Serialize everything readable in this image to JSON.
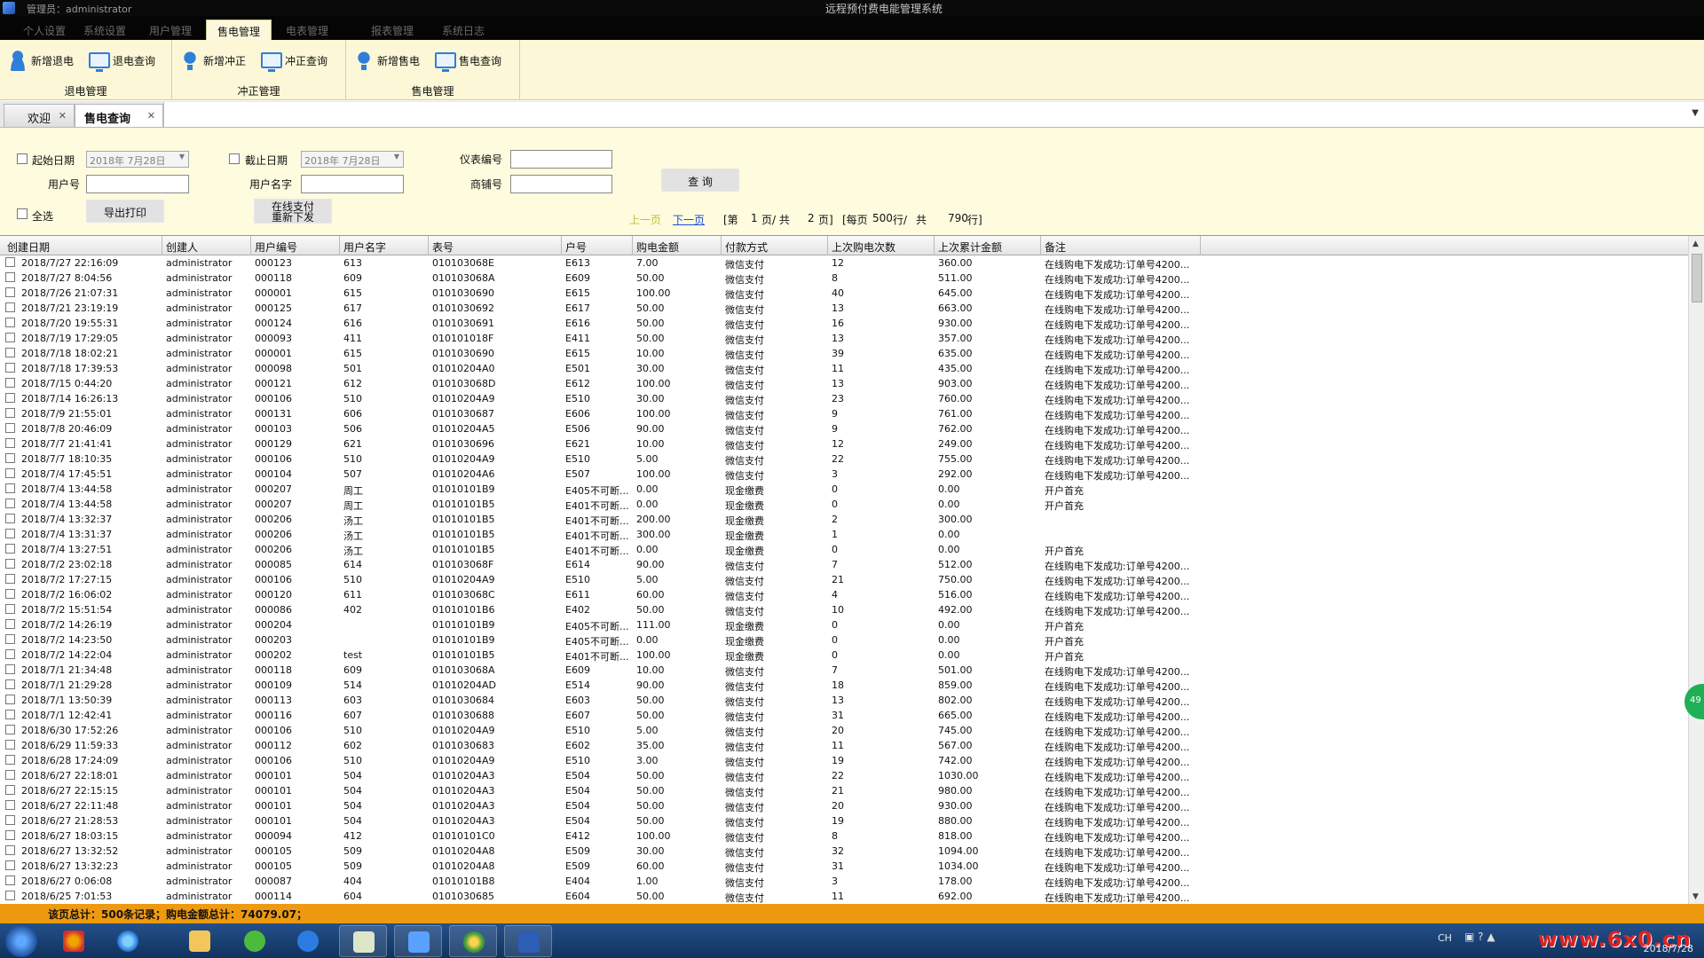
{
  "window": {
    "title": "远程预付费电能管理系统",
    "login_text": "管理员：administrator"
  },
  "ribbon": {
    "tabs": [
      "个人设置",
      "系统设置",
      "用户管理",
      "售电管理",
      "电表管理",
      "报表管理",
      "系统日志"
    ],
    "active_tab": "售电管理",
    "groups": [
      {
        "label": "退电管理",
        "buttons": [
          {
            "label": "新增退电",
            "icon": "person-add-icon"
          },
          {
            "label": "退电查询",
            "icon": "monitor-search-icon"
          }
        ]
      },
      {
        "label": "冲正管理",
        "buttons": [
          {
            "label": "新增冲正",
            "icon": "bulb-add-icon"
          },
          {
            "label": "冲正查询",
            "icon": "monitor-search-icon"
          }
        ]
      },
      {
        "label": "售电管理",
        "buttons": [
          {
            "label": "新增售电",
            "icon": "bulb-add-icon"
          },
          {
            "label": "售电查询",
            "icon": "monitor-search-icon"
          }
        ]
      }
    ]
  },
  "doc_tabs": [
    {
      "label": "欢迎",
      "active": false
    },
    {
      "label": "售电查询",
      "active": true
    }
  ],
  "filter": {
    "start_date_label": "起始日期",
    "start_date_value": "2018年 7月28日",
    "end_date_label": "截止日期",
    "end_date_value": "2018年 7月28日",
    "meter_label": "仪表编号",
    "user_no_label": "用户号",
    "user_name_label": "用户名字",
    "shop_label": "商铺号",
    "query_button": "查 询",
    "select_all_label": "全选",
    "export_button": "导出打印",
    "resend_button_line1": "在线支付",
    "resend_button_line2": "重新下发"
  },
  "pagination": {
    "prev": "上一页",
    "next": "下一页",
    "page_open": "[第",
    "current_page": "1",
    "page_mid": "页/ 共",
    "total_pages": "2",
    "page_close": "页]",
    "per_page_open": "[每页",
    "per_page": "500",
    "rows_mid": "行/",
    "total_label": "共",
    "total_rows": "790",
    "rows_close": "行]"
  },
  "table": {
    "columns": [
      "创建日期",
      "创建人",
      "用户编号",
      "用户名字",
      "表号",
      "户号",
      "购电金额",
      "付款方式",
      "上次购电次数",
      "上次累计金额",
      "备注"
    ],
    "rows": [
      [
        "2018/7/27 22:16:09",
        "administrator",
        "000123",
        "613",
        "010103068E",
        "E613",
        "7.00",
        "微信支付",
        "12",
        "360.00",
        "在线购电下发成功:订单号4200..."
      ],
      [
        "2018/7/27 8:04:56",
        "administrator",
        "000118",
        "609",
        "010103068A",
        "E609",
        "50.00",
        "微信支付",
        "8",
        "511.00",
        "在线购电下发成功:订单号4200..."
      ],
      [
        "2018/7/26 21:07:31",
        "administrator",
        "000001",
        "615",
        "0101030690",
        "E615",
        "100.00",
        "微信支付",
        "40",
        "645.00",
        "在线购电下发成功:订单号4200..."
      ],
      [
        "2018/7/21 23:19:19",
        "administrator",
        "000125",
        "617",
        "0101030692",
        "E617",
        "50.00",
        "微信支付",
        "13",
        "663.00",
        "在线购电下发成功:订单号4200..."
      ],
      [
        "2018/7/20 19:55:31",
        "administrator",
        "000124",
        "616",
        "0101030691",
        "E616",
        "50.00",
        "微信支付",
        "16",
        "930.00",
        "在线购电下发成功:订单号4200..."
      ],
      [
        "2018/7/19 17:29:05",
        "administrator",
        "000093",
        "411",
        "010101018F",
        "E411",
        "50.00",
        "微信支付",
        "13",
        "357.00",
        "在线购电下发成功:订单号4200..."
      ],
      [
        "2018/7/18 18:02:21",
        "administrator",
        "000001",
        "615",
        "0101030690",
        "E615",
        "10.00",
        "微信支付",
        "39",
        "635.00",
        "在线购电下发成功:订单号4200..."
      ],
      [
        "2018/7/18 17:39:53",
        "administrator",
        "000098",
        "501",
        "01010204A0",
        "E501",
        "30.00",
        "微信支付",
        "11",
        "435.00",
        "在线购电下发成功:订单号4200..."
      ],
      [
        "2018/7/15 0:44:20",
        "administrator",
        "000121",
        "612",
        "010103068D",
        "E612",
        "100.00",
        "微信支付",
        "13",
        "903.00",
        "在线购电下发成功:订单号4200..."
      ],
      [
        "2018/7/14 16:26:13",
        "administrator",
        "000106",
        "510",
        "01010204A9",
        "E510",
        "30.00",
        "微信支付",
        "23",
        "760.00",
        "在线购电下发成功:订单号4200..."
      ],
      [
        "2018/7/9 21:55:01",
        "administrator",
        "000131",
        "606",
        "0101030687",
        "E606",
        "100.00",
        "微信支付",
        "9",
        "761.00",
        "在线购电下发成功:订单号4200..."
      ],
      [
        "2018/7/8 20:46:09",
        "administrator",
        "000103",
        "506",
        "01010204A5",
        "E506",
        "90.00",
        "微信支付",
        "9",
        "762.00",
        "在线购电下发成功:订单号4200..."
      ],
      [
        "2018/7/7 21:41:41",
        "administrator",
        "000129",
        "621",
        "0101030696",
        "E621",
        "10.00",
        "微信支付",
        "12",
        "249.00",
        "在线购电下发成功:订单号4200..."
      ],
      [
        "2018/7/7 18:10:35",
        "administrator",
        "000106",
        "510",
        "01010204A9",
        "E510",
        "5.00",
        "微信支付",
        "22",
        "755.00",
        "在线购电下发成功:订单号4200..."
      ],
      [
        "2018/7/4 17:45:51",
        "administrator",
        "000104",
        "507",
        "01010204A6",
        "E507",
        "100.00",
        "微信支付",
        "3",
        "292.00",
        "在线购电下发成功:订单号4200..."
      ],
      [
        "2018/7/4 13:44:58",
        "administrator",
        "000207",
        "周工",
        "01010101B9",
        "E405不可断...",
        "0.00",
        "现金缴费",
        "0",
        "0.00",
        "开户首充"
      ],
      [
        "2018/7/4 13:44:58",
        "administrator",
        "000207",
        "周工",
        "01010101B5",
        "E401不可断...",
        "0.00",
        "现金缴费",
        "0",
        "0.00",
        "开户首充"
      ],
      [
        "2018/7/4 13:32:37",
        "administrator",
        "000206",
        "汤工",
        "01010101B5",
        "E401不可断...",
        "200.00",
        "现金缴费",
        "2",
        "300.00",
        ""
      ],
      [
        "2018/7/4 13:31:37",
        "administrator",
        "000206",
        "汤工",
        "01010101B5",
        "E401不可断...",
        "300.00",
        "现金缴费",
        "1",
        "0.00",
        ""
      ],
      [
        "2018/7/4 13:27:51",
        "administrator",
        "000206",
        "汤工",
        "01010101B5",
        "E401不可断...",
        "0.00",
        "现金缴费",
        "0",
        "0.00",
        "开户首充"
      ],
      [
        "2018/7/2 23:02:18",
        "administrator",
        "000085",
        "614",
        "010103068F",
        "E614",
        "90.00",
        "微信支付",
        "7",
        "512.00",
        "在线购电下发成功:订单号4200..."
      ],
      [
        "2018/7/2 17:27:15",
        "administrator",
        "000106",
        "510",
        "01010204A9",
        "E510",
        "5.00",
        "微信支付",
        "21",
        "750.00",
        "在线购电下发成功:订单号4200..."
      ],
      [
        "2018/7/2 16:06:02",
        "administrator",
        "000120",
        "611",
        "010103068C",
        "E611",
        "60.00",
        "微信支付",
        "4",
        "516.00",
        "在线购电下发成功:订单号4200..."
      ],
      [
        "2018/7/2 15:51:54",
        "administrator",
        "000086",
        "402",
        "01010101B6",
        "E402",
        "50.00",
        "微信支付",
        "10",
        "492.00",
        "在线购电下发成功:订单号4200..."
      ],
      [
        "2018/7/2 14:26:19",
        "administrator",
        "000204",
        "",
        "01010101B9",
        "E405不可断...",
        "111.00",
        "现金缴费",
        "0",
        "0.00",
        "开户首充"
      ],
      [
        "2018/7/2 14:23:50",
        "administrator",
        "000203",
        "",
        "01010101B9",
        "E405不可断...",
        "0.00",
        "现金缴费",
        "0",
        "0.00",
        "开户首充"
      ],
      [
        "2018/7/2 14:22:04",
        "administrator",
        "000202",
        "test",
        "01010101B5",
        "E401不可断...",
        "100.00",
        "现金缴费",
        "0",
        "0.00",
        "开户首充"
      ],
      [
        "2018/7/1 21:34:48",
        "administrator",
        "000118",
        "609",
        "010103068A",
        "E609",
        "10.00",
        "微信支付",
        "7",
        "501.00",
        "在线购电下发成功:订单号4200..."
      ],
      [
        "2018/7/1 21:29:28",
        "administrator",
        "000109",
        "514",
        "01010204AD",
        "E514",
        "90.00",
        "微信支付",
        "18",
        "859.00",
        "在线购电下发成功:订单号4200..."
      ],
      [
        "2018/7/1 13:50:39",
        "administrator",
        "000113",
        "603",
        "0101030684",
        "E603",
        "50.00",
        "微信支付",
        "13",
        "802.00",
        "在线购电下发成功:订单号4200..."
      ],
      [
        "2018/7/1 12:42:41",
        "administrator",
        "000116",
        "607",
        "0101030688",
        "E607",
        "50.00",
        "微信支付",
        "31",
        "665.00",
        "在线购电下发成功:订单号4200..."
      ],
      [
        "2018/6/30 17:52:26",
        "administrator",
        "000106",
        "510",
        "01010204A9",
        "E510",
        "5.00",
        "微信支付",
        "20",
        "745.00",
        "在线购电下发成功:订单号4200..."
      ],
      [
        "2018/6/29 11:59:33",
        "administrator",
        "000112",
        "602",
        "0101030683",
        "E602",
        "35.00",
        "微信支付",
        "11",
        "567.00",
        "在线购电下发成功:订单号4200..."
      ],
      [
        "2018/6/28 17:24:09",
        "administrator",
        "000106",
        "510",
        "01010204A9",
        "E510",
        "3.00",
        "微信支付",
        "19",
        "742.00",
        "在线购电下发成功:订单号4200..."
      ],
      [
        "2018/6/27 22:18:01",
        "administrator",
        "000101",
        "504",
        "01010204A3",
        "E504",
        "50.00",
        "微信支付",
        "22",
        "1030.00",
        "在线购电下发成功:订单号4200..."
      ],
      [
        "2018/6/27 22:15:15",
        "administrator",
        "000101",
        "504",
        "01010204A3",
        "E504",
        "50.00",
        "微信支付",
        "21",
        "980.00",
        "在线购电下发成功:订单号4200..."
      ],
      [
        "2018/6/27 22:11:48",
        "administrator",
        "000101",
        "504",
        "01010204A3",
        "E504",
        "50.00",
        "微信支付",
        "20",
        "930.00",
        "在线购电下发成功:订单号4200..."
      ],
      [
        "2018/6/27 21:28:53",
        "administrator",
        "000101",
        "504",
        "01010204A3",
        "E504",
        "50.00",
        "微信支付",
        "19",
        "880.00",
        "在线购电下发成功:订单号4200..."
      ],
      [
        "2018/6/27 18:03:15",
        "administrator",
        "000094",
        "412",
        "01010101C0",
        "E412",
        "100.00",
        "微信支付",
        "8",
        "818.00",
        "在线购电下发成功:订单号4200..."
      ],
      [
        "2018/6/27 13:32:52",
        "administrator",
        "000105",
        "509",
        "01010204A8",
        "E509",
        "30.00",
        "微信支付",
        "32",
        "1094.00",
        "在线购电下发成功:订单号4200..."
      ],
      [
        "2018/6/27 13:32:23",
        "administrator",
        "000105",
        "509",
        "01010204A8",
        "E509",
        "60.00",
        "微信支付",
        "31",
        "1034.00",
        "在线购电下发成功:订单号4200..."
      ],
      [
        "2018/6/27 0:06:08",
        "administrator",
        "000087",
        "404",
        "01010101B8",
        "E404",
        "1.00",
        "微信支付",
        "3",
        "178.00",
        "在线购电下发成功:订单号4200..."
      ],
      [
        "2018/6/25 7:01:53",
        "administrator",
        "000114",
        "604",
        "0101030685",
        "E604",
        "50.00",
        "微信支付",
        "11",
        "692.00",
        "在线购电下发成功:订单号4200..."
      ]
    ]
  },
  "status_bar": "该页总计：500条记录；购电金额总计：74079.07；",
  "side_badge": "49",
  "taskbar": {
    "lang": "CH",
    "date": "2018/7/28",
    "watermark": "www.6x0.cn",
    "apps": [
      "ie-icon",
      "explorer-folder-icon",
      "refresh-app-icon",
      "s-app-icon",
      "terminal-icon",
      "app-window-icon",
      "chrome-icon",
      "word-icon"
    ]
  },
  "colors": {
    "ribbon_bg": "#fbf7d7",
    "status_bg": "#ee9a10",
    "link": "#1a4bd8",
    "taskbar": "#1b3f72"
  }
}
